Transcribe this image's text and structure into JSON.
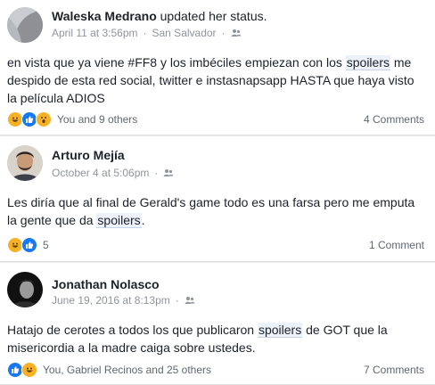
{
  "posts": [
    {
      "author": "Waleska Medrano",
      "action": "updated her status.",
      "date": "April 11 at 3:56pm",
      "location": "San Salvador",
      "text_before": "en vista que ya viene #FF8 y los imbéciles empiezan con los ",
      "keyword": "spoilers",
      "text_after": " me despido de esta red social, twitter e instasnapsapp HASTA que haya visto la película ADIOS",
      "reactions": [
        "haha",
        "like",
        "wow"
      ],
      "reaction_text": "You and 9 others",
      "comments": "4 Comments"
    },
    {
      "author": "Arturo Mejía",
      "action": "",
      "date": "October 4 at 5:06pm",
      "location": "",
      "text_before": "Les diría que al final de Gerald's game todo es una farsa pero me emputa la gente que da ",
      "keyword": "spoilers",
      "text_after": ".",
      "reactions": [
        "haha",
        "like"
      ],
      "reaction_text": "5",
      "comments": "1 Comment"
    },
    {
      "author": "Jonathan Nolasco",
      "action": "",
      "date": "June 19, 2016 at 8:13pm",
      "location": "",
      "text_before": "Hatajo de cerotes a todos los que publicaron ",
      "keyword": "spoilers",
      "text_after": " de GOT que la misericordia a la madre caiga sobre ustedes.",
      "reactions": [
        "like",
        "haha"
      ],
      "reaction_text": "You, Gabriel Recinos and 25 others",
      "comments": "7 Comments"
    }
  ],
  "colors": {
    "link": "#365899",
    "meta": "#90949c",
    "like": "#1877f2",
    "haha": "#f7b125"
  },
  "icons": {
    "audience": "friends-icon",
    "like": "thumbs-up-icon",
    "haha": "laughing-face-icon",
    "wow": "surprised-face-icon"
  }
}
